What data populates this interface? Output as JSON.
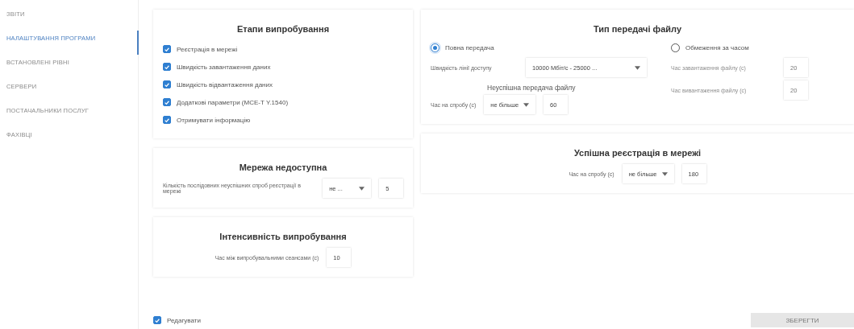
{
  "sidebar": {
    "items": [
      {
        "label": "ЗВІТИ",
        "selected": false
      },
      {
        "label": "НАЛАШТУВАННЯ ПРОГРАМИ",
        "selected": true
      },
      {
        "label": "ВСТАНОВЛЕНІ РІВНІ",
        "selected": false
      },
      {
        "label": "СЕРВЕРИ",
        "selected": false
      },
      {
        "label": "ПОСТАЧАЛЬНИКИ ПОСЛУГ",
        "selected": false
      },
      {
        "label": "ФАХІВЦІ",
        "selected": false
      }
    ]
  },
  "stages": {
    "title": "Етапи випробування",
    "items": [
      {
        "label": "Реєстрація в мережі",
        "checked": true
      },
      {
        "label": "Швидкість завантаження даних",
        "checked": true
      },
      {
        "label": "Швидкість відвантаження даних",
        "checked": true
      },
      {
        "label": "Додаткові параметри (МСЕ-Т Y.1540)",
        "checked": true
      },
      {
        "label": "Отримувати інформацію",
        "checked": true
      }
    ]
  },
  "unavailable": {
    "title": "Мережа недоступна",
    "label": "Кількість послідовних неуспішних спроб реєстрації в мережі",
    "select": "не ...",
    "value": "5"
  },
  "intensity": {
    "title": "Інтенсивність випробування",
    "label": "Час між випробувальними сеансами (с)",
    "value": "10"
  },
  "transfer": {
    "title": "Тип передачі файлу",
    "full": {
      "label": "Повна передача",
      "selected": true,
      "speed_label": "Швидкість лінії доступу",
      "speed_value": "10000 Мбіт/с - 25000 ...",
      "failed_title": "Неуспішна передача файлу",
      "time_label": "Час на спробу (с)",
      "time_select": "не більше",
      "time_value": "60"
    },
    "limited": {
      "label": "Обмеження за часом",
      "selected": false,
      "fields": [
        {
          "label": "Час завантаження файлу (с)",
          "value": "20",
          "disabled": true
        },
        {
          "label": "Час вивантаження файлу (с)",
          "value": "20",
          "disabled": true
        }
      ]
    }
  },
  "success": {
    "title": "Успішна реєстрація в мережі",
    "label": "Час на спробу (с)",
    "select": "не більше",
    "value": "180"
  },
  "edit": {
    "label": "Редагувати",
    "checked": true
  },
  "save_button": {
    "label": "ЗБЕРЕГТИ",
    "disabled": true
  }
}
